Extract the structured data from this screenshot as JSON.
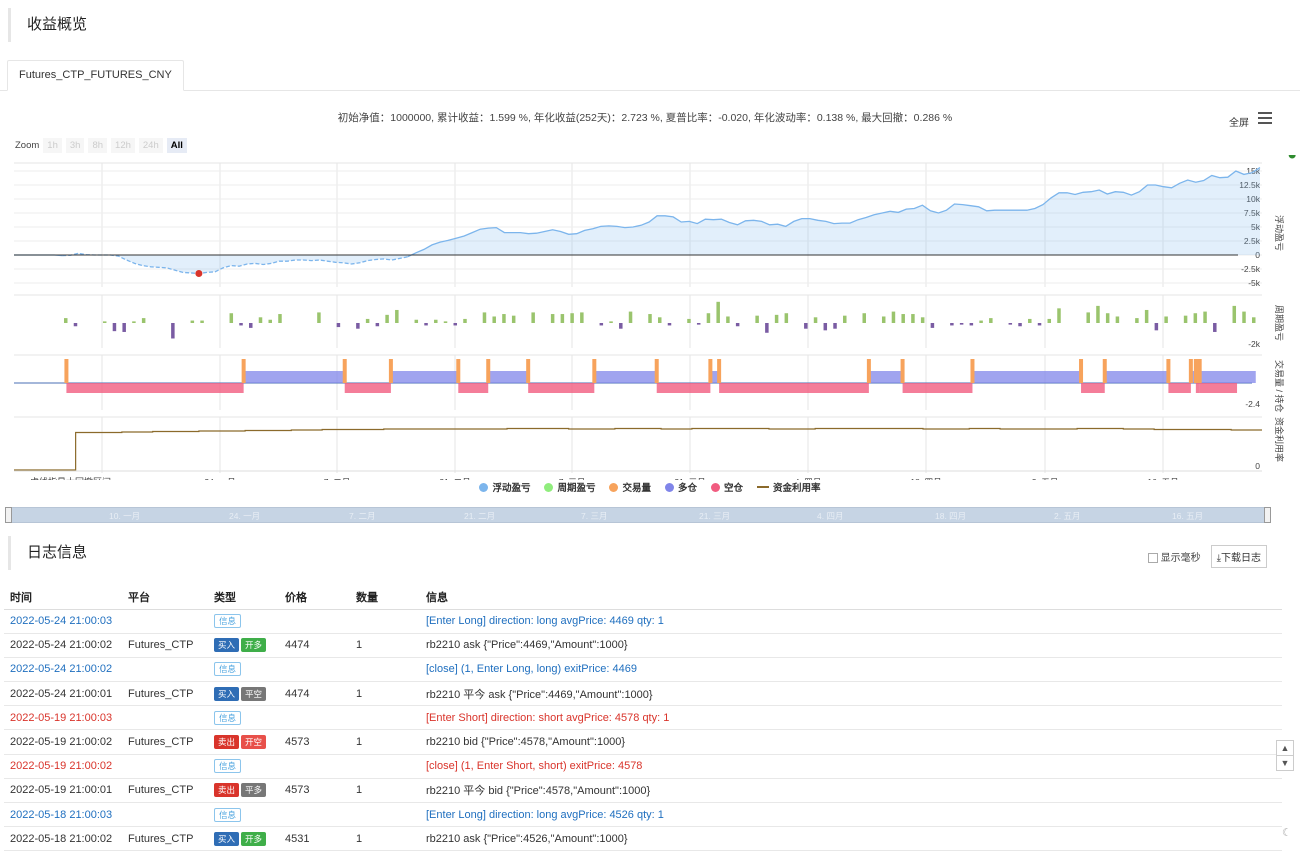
{
  "overview_title": "收益概览",
  "tab_label": "Futures_CTP_FUTURES_CNY",
  "summary_text": "初始净值：1000000, 累计收益：1.599 %, 年化收益(252天)：2.723 %, 夏普比率：-0.020, 年化波动率：0.138 %, 最大回撤：0.286 %",
  "fullscreen_label": "全屏",
  "zoom": {
    "label": "Zoom",
    "buttons": [
      "1h",
      "3h",
      "8h",
      "12h",
      "24h",
      "All"
    ],
    "active": "All"
  },
  "chart_note": "虚线指最大回撤区间",
  "colors": {
    "float": "#7cb5ec",
    "period": "#90ed7d",
    "volume": "#f7a35c",
    "long": "#8085e9",
    "short": "#f15c80",
    "util": "#8b6a2b"
  },
  "chart_data": {
    "type": "line",
    "x_tick_labels": [
      "10. 一月",
      "24. 一月",
      "7. 二月",
      "21. 二月",
      "7. 三月",
      "21. 三月",
      "4. 四月",
      "18. 四月",
      "2. 五月",
      "16. 五月"
    ],
    "panels": [
      {
        "name": "浮动盈亏",
        "type": "area",
        "y_ticks": [
          "15k",
          "12.5k",
          "10k",
          "7.5k",
          "5k",
          "2.5k",
          "0",
          "-2.5k",
          "-5k"
        ],
        "ylim": [
          -5000,
          15000
        ],
        "values": [
          0,
          0,
          0,
          0,
          0,
          0,
          -100,
          -50,
          300,
          50,
          0,
          0,
          0,
          -200,
          -900,
          -1500,
          -1900,
          -2100,
          -2200,
          -2300,
          -2700,
          -3100,
          -3200,
          -3300,
          -3100,
          -3000,
          -2300,
          -1900,
          -2000,
          -1600,
          -1500,
          -1700,
          -1500,
          -1100,
          -1100,
          -900,
          -900,
          -1000,
          -900,
          -1100,
          -1300,
          -1400,
          -1600,
          -1400,
          -1000,
          -800,
          -700,
          -900,
          -600,
          -300,
          400,
          1000,
          1800,
          2300,
          2600,
          3000,
          3400,
          4000,
          4600,
          4800,
          4900,
          4000,
          4000,
          4000,
          3800,
          3900,
          4200,
          4500,
          4200,
          3700,
          3800,
          4400,
          4700,
          5100,
          5200,
          5100,
          4900,
          5000,
          5300,
          5900,
          7000,
          7000,
          6800,
          5900,
          6000,
          5600,
          6400,
          6300,
          6400,
          5800,
          5400,
          6100,
          6200,
          6000,
          5400,
          5500,
          5100,
          6000,
          6500,
          6500,
          6200,
          6000,
          5600,
          5700,
          5700,
          6300,
          6700,
          7200,
          7500,
          7800,
          7600,
          8200,
          8300,
          8900,
          7900,
          7500,
          8000,
          9100,
          9000,
          8800,
          8600,
          7900,
          8000,
          8000,
          8000,
          8000,
          8000,
          8300,
          9000,
          10200,
          11100,
          11100,
          10800,
          11200,
          11300,
          11600,
          10900,
          11300,
          11200,
          10700,
          11300,
          12500,
          12500,
          12200,
          12000,
          12800,
          13400,
          13000,
          13300,
          14200,
          13800,
          13900,
          15000,
          14400,
          14700,
          15600
        ],
        "max_drawdown_marks": [
          {
            "series_index": 23,
            "color": "#d9342b"
          },
          {
            "series_index": 159,
            "color": "#2e8b2e"
          }
        ]
      },
      {
        "name": "周期盈亏",
        "type": "bar",
        "y_ticks": [
          "-2k"
        ],
        "values": [
          600,
          -400,
          0,
          0,
          200,
          -1000,
          -1100,
          200,
          600,
          0,
          0,
          -1900,
          0,
          300,
          300,
          0,
          0,
          1200,
          -300,
          -600,
          700,
          400,
          1100,
          0,
          0,
          0,
          1300,
          0,
          -500,
          0,
          -700,
          500,
          -400,
          1000,
          1600,
          0,
          400,
          -300,
          400,
          200,
          -300,
          500,
          0,
          1300,
          800,
          1100,
          900,
          0,
          1300,
          0,
          1100,
          1100,
          1200,
          1300,
          0,
          -300,
          200,
          -700,
          1400,
          0,
          1100,
          700,
          -300,
          0,
          500,
          -200,
          1200,
          2600,
          800,
          -400,
          0,
          900,
          -1200,
          1000,
          1200,
          0,
          -700,
          700,
          -900,
          -700,
          900,
          0,
          1200,
          0,
          800,
          1400,
          1100,
          1100,
          700,
          -600,
          0,
          -300,
          -200,
          -300,
          300,
          600,
          0,
          -200,
          -400,
          500,
          -300,
          500,
          1800,
          0,
          0,
          1300,
          2100,
          1200,
          800,
          0,
          600,
          1600,
          -900,
          800,
          0,
          900,
          1200,
          1400,
          -1100,
          0,
          2100,
          1400,
          700
        ],
        "positive_color": "#9ac46d",
        "negative_color": "#7a5ca3"
      },
      {
        "name": "交易量 / 持仓",
        "type": "position",
        "y_ticks": [
          "-2.4"
        ],
        "long_segments": [
          [
            0.184,
            0.265
          ],
          [
            0.302,
            0.356
          ],
          [
            0.38,
            0.412
          ],
          [
            0.465,
            0.515
          ],
          [
            0.558,
            0.565
          ],
          [
            0.685,
            0.712
          ],
          [
            0.768,
            0.855
          ],
          [
            0.874,
            0.925
          ],
          [
            0.943,
            0.947
          ],
          [
            0.95,
            0.995
          ]
        ],
        "short_segments": [
          [
            0.042,
            0.184
          ],
          [
            0.265,
            0.302
          ],
          [
            0.356,
            0.38
          ],
          [
            0.412,
            0.465
          ],
          [
            0.515,
            0.558
          ],
          [
            0.565,
            0.685
          ],
          [
            0.712,
            0.768
          ],
          [
            0.855,
            0.874
          ],
          [
            0.925,
            0.943
          ],
          [
            0.947,
            0.95
          ],
          [
            0.95,
            0.98
          ]
        ]
      },
      {
        "name": "资金利用率",
        "type": "step",
        "y_ticks": [
          "0"
        ],
        "values": [
          0,
          0,
          0,
          0,
          75,
          75,
          75,
          76,
          76,
          77,
          77,
          77,
          78,
          78,
          78,
          79,
          79,
          79,
          80,
          80,
          81,
          81,
          81,
          81,
          82,
          82,
          82,
          82,
          82,
          82,
          82,
          82,
          83,
          83,
          83,
          83,
          82,
          82,
          82,
          83,
          83,
          83,
          82,
          82,
          83,
          83,
          83,
          83,
          83,
          82,
          82,
          82,
          83,
          83,
          83,
          83,
          83,
          83,
          83,
          82,
          82,
          82,
          83,
          83,
          82,
          82,
          82,
          82,
          82,
          83,
          83,
          83,
          82,
          82,
          81,
          81,
          81,
          81,
          81,
          80,
          80,
          80
        ]
      }
    ],
    "legend": [
      "浮动盈亏",
      "周期盈亏",
      "交易量",
      "多仓",
      "空仓",
      "资金利用率"
    ]
  },
  "navigator_labels": [
    "10. 一月",
    "24. 一月",
    "7. 二月",
    "21. 二月",
    "7. 三月",
    "21. 三月",
    "4. 四月",
    "18. 四月",
    "2. 五月",
    "16. 五月"
  ],
  "log": {
    "title": "日志信息",
    "show_ms_label": "显示毫秒",
    "download_label": "下载日志",
    "columns": [
      "时间",
      "平台",
      "类型",
      "价格",
      "数量",
      "信息"
    ],
    "rows": [
      {
        "time": "2022-05-24 21:00:03",
        "platform": "",
        "badges": [
          {
            "text": "信息",
            "kind": "info"
          }
        ],
        "price": "",
        "qty": "",
        "msg": "[Enter Long] direction: long avgPrice: 4469 qty: 1",
        "color": "blue"
      },
      {
        "time": "2022-05-24 21:00:02",
        "platform": "Futures_CTP",
        "badges": [
          {
            "text": "买入",
            "kind": "buy"
          },
          {
            "text": "开多",
            "kind": "open-long"
          }
        ],
        "price": "4474",
        "qty": "1",
        "msg": "rb2210 ask {\"Price\":4469,\"Amount\":1000}",
        "color": ""
      },
      {
        "time": "2022-05-24 21:00:02",
        "platform": "",
        "badges": [
          {
            "text": "信息",
            "kind": "info"
          }
        ],
        "price": "",
        "qty": "",
        "msg": "[close] (1, Enter Long, long) exitPrice: 4469",
        "color": "blue"
      },
      {
        "time": "2022-05-24 21:00:01",
        "platform": "Futures_CTP",
        "badges": [
          {
            "text": "买入",
            "kind": "buy"
          },
          {
            "text": "平空",
            "kind": "close"
          }
        ],
        "price": "4474",
        "qty": "1",
        "msg": "rb2210 平今 ask {\"Price\":4469,\"Amount\":1000}",
        "color": ""
      },
      {
        "time": "2022-05-19 21:00:03",
        "platform": "",
        "badges": [
          {
            "text": "信息",
            "kind": "info"
          }
        ],
        "price": "",
        "qty": "",
        "msg": "[Enter Short] direction: short avgPrice: 4578 qty: 1",
        "color": "red"
      },
      {
        "time": "2022-05-19 21:00:02",
        "platform": "Futures_CTP",
        "badges": [
          {
            "text": "卖出",
            "kind": "sell"
          },
          {
            "text": "开空",
            "kind": "open-short"
          }
        ],
        "price": "4573",
        "qty": "1",
        "msg": "rb2210 bid {\"Price\":4578,\"Amount\":1000}",
        "color": ""
      },
      {
        "time": "2022-05-19 21:00:02",
        "platform": "",
        "badges": [
          {
            "text": "信息",
            "kind": "info"
          }
        ],
        "price": "",
        "qty": "",
        "msg": "[close] (1, Enter Short, short) exitPrice: 4578",
        "color": "red"
      },
      {
        "time": "2022-05-19 21:00:01",
        "platform": "Futures_CTP",
        "badges": [
          {
            "text": "卖出",
            "kind": "sell"
          },
          {
            "text": "平多",
            "kind": "close"
          }
        ],
        "price": "4573",
        "qty": "1",
        "msg": "rb2210 平今 bid {\"Price\":4578,\"Amount\":1000}",
        "color": ""
      },
      {
        "time": "2022-05-18 21:00:03",
        "platform": "",
        "badges": [
          {
            "text": "信息",
            "kind": "info"
          }
        ],
        "price": "",
        "qty": "",
        "msg": "[Enter Long] direction: long avgPrice: 4526 qty: 1",
        "color": "blue"
      },
      {
        "time": "2022-05-18 21:00:02",
        "platform": "Futures_CTP",
        "badges": [
          {
            "text": "买入",
            "kind": "buy"
          },
          {
            "text": "开多",
            "kind": "open-long"
          }
        ],
        "price": "4531",
        "qty": "1",
        "msg": "rb2210 ask {\"Price\":4526,\"Amount\":1000}",
        "color": ""
      }
    ],
    "badge_colors": {
      "buy": "#2f6db5",
      "sell": "#d9342b",
      "open-long": "#3fae49",
      "open-short": "#e8504a",
      "close": "#777777"
    }
  }
}
